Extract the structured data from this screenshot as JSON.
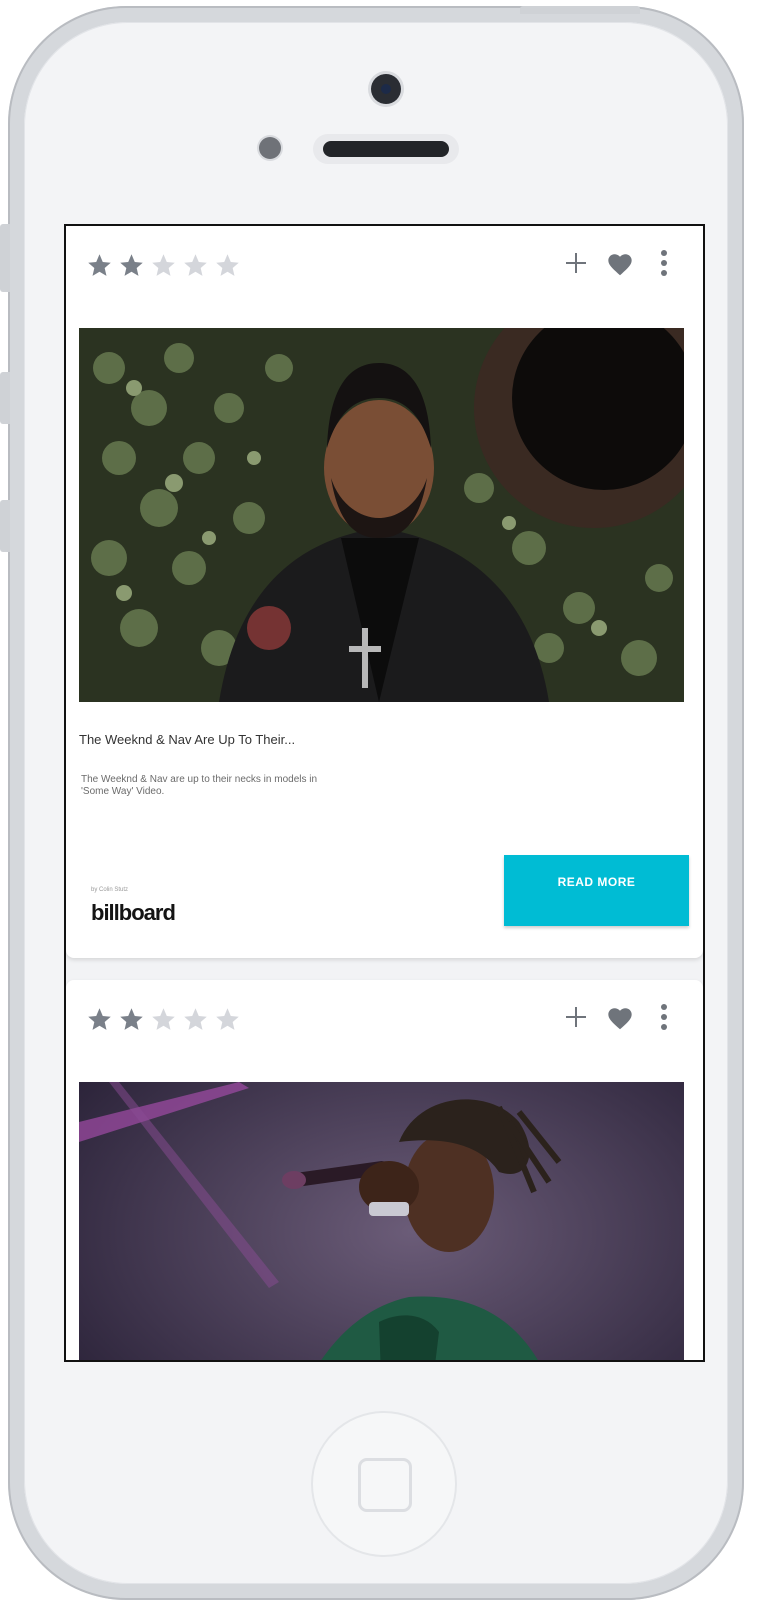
{
  "feed": [
    {
      "rating": 2,
      "rating_max": 5,
      "title": "The Weeknd & Nav Are Up To Their...",
      "description": "The Weeknd & Nav are up to their necks in models in 'Some Way' Video.",
      "byline": "by Colin Stutz",
      "source": "billboard",
      "button_label": "READ MORE"
    },
    {
      "rating": 2,
      "rating_max": 5
    }
  ],
  "icons": {
    "add": "plus-icon",
    "favorite": "heart-icon",
    "menu": "more-vertical-icon",
    "star": "star-icon"
  },
  "colors": {
    "accent": "#00bcd4",
    "star_filled": "#7a8089",
    "star_empty": "#d4d6db",
    "icon": "#6f747b"
  }
}
